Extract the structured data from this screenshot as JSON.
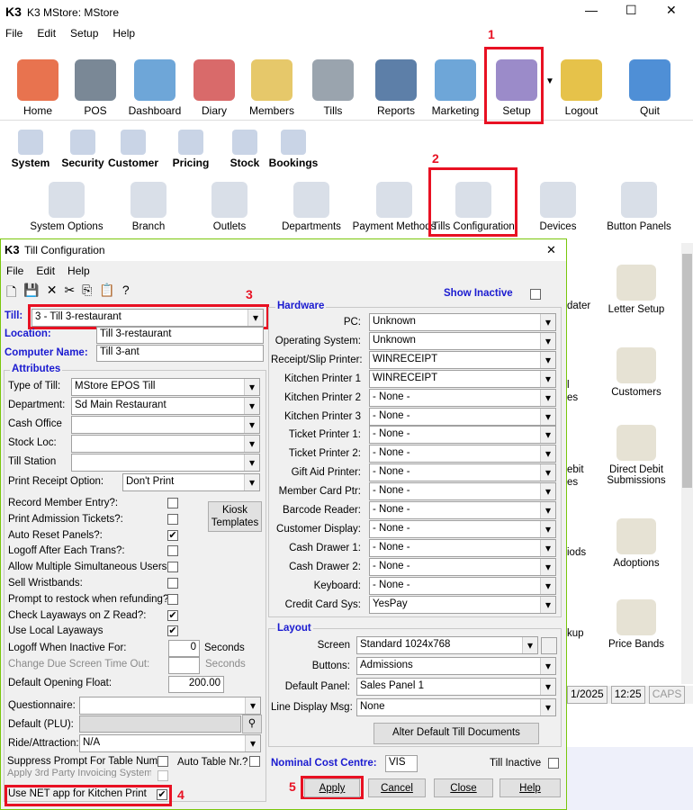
{
  "window": {
    "logo": "K3",
    "title": "K3 MStore: MStore"
  },
  "menu": [
    "File",
    "Edit",
    "Setup",
    "Help"
  ],
  "toolbar": [
    {
      "label": "Home",
      "icon": "house-icon",
      "color": "#e8734f"
    },
    {
      "label": "POS",
      "icon": "pos-terminal-icon",
      "color": "#7a8896"
    },
    {
      "label": "Dashboard",
      "icon": "dashboard-icon",
      "color": "#6ea6d8"
    },
    {
      "label": "Diary",
      "icon": "calendar-icon",
      "color": "#d96a6a"
    },
    {
      "label": "Members",
      "icon": "members-icon",
      "color": "#e6c86a"
    },
    {
      "label": "Tills",
      "icon": "till-icon",
      "color": "#9aa4ae"
    },
    {
      "label": "Reports",
      "icon": "reports-icon",
      "color": "#5d7fa8"
    },
    {
      "label": "Marketing",
      "icon": "network-icon",
      "color": "#6ea6d8"
    },
    {
      "label": "Setup",
      "icon": "gears-icon",
      "color": "#9b8bc9"
    },
    {
      "label": "Logout",
      "icon": "key-icon",
      "color": "#e6c24a"
    },
    {
      "label": "Quit",
      "icon": "arrow-right-icon",
      "color": "#4f8fd6"
    }
  ],
  "subtoolbar": [
    {
      "label": "System",
      "icon": "gears-icon"
    },
    {
      "label": "Security",
      "icon": "shield-icon"
    },
    {
      "label": "Customer",
      "icon": "person-icon"
    },
    {
      "label": "Pricing",
      "icon": "price-tag-icon"
    },
    {
      "label": "Stock",
      "icon": "box-icon"
    },
    {
      "label": "Bookings",
      "icon": "building-icon"
    }
  ],
  "setup_icons": [
    "System Options",
    "Branch",
    "Outlets",
    "Departments",
    "Payment Methods",
    "Tills Configuration",
    "Devices",
    "Button Panels"
  ],
  "right_icons": [
    "Letter Setup",
    "Customers",
    "Direct Debit Submissions",
    "Adoptions",
    "Price Bands"
  ],
  "right_partial": [
    "dater",
    "l",
    "es",
    "ebit",
    "es",
    "iods",
    "kup"
  ],
  "status": {
    "date": "1/2025",
    "time": "12:25",
    "caps": "CAPS"
  },
  "annotations": [
    "1",
    "2",
    "3",
    "4",
    "5"
  ],
  "dialog": {
    "logo": "K3",
    "title": "Till Configuration",
    "close": "✕",
    "menu": [
      "File",
      "Edit",
      "Help"
    ],
    "show_inactive": "Show Inactive",
    "till_label": "Till:",
    "till_value": "3 - Till 3-restaurant",
    "location_label": "Location:",
    "location_value": "Till 3-restaurant",
    "computer_label": "Computer Name:",
    "computer_value": "Till 3-ant",
    "attributes": {
      "title": "Attributes",
      "type_label": "Type of Till:",
      "type_value": "MStore EPOS Till",
      "dept_label": "Department:",
      "dept_value": "Sd Main Restaurant",
      "cash_label": "Cash Office",
      "stock_label": "Stock Loc:",
      "station_label": "Till Station",
      "receipt_label": "Print Receipt Option:",
      "receipt_value": "Don't Print",
      "kiosk": "Kiosk Templates",
      "checks": [
        {
          "label": "Record Member Entry?:",
          "checked": false
        },
        {
          "label": "Print Admission Tickets?:",
          "checked": false
        },
        {
          "label": "Auto Reset Panels?:",
          "checked": true
        },
        {
          "label": "Logoff After Each Trans?:",
          "checked": false
        },
        {
          "label": "Allow Multiple Simultaneous Users?:",
          "checked": false
        },
        {
          "label": "Sell Wristbands:",
          "checked": false
        },
        {
          "label": "Prompt to restock when refunding?:",
          "checked": false
        },
        {
          "label": "Check Layaways on Z Read?:",
          "checked": true
        },
        {
          "label": "Use Local Layaways",
          "checked": true
        }
      ],
      "logoff_label": "Logoff When Inactive For:",
      "logoff_value": "0",
      "seconds": "Seconds",
      "change_label": "Change Due Screen Time Out:",
      "float_label": "Default Opening Float:",
      "float_value": "200.00",
      "quest_label": "Questionnaire:",
      "plu_label": "Default (PLU):",
      "ride_label": "Ride/Attraction:",
      "ride_value": "N/A",
      "suppress_label": "Suppress Prompt For Table Num?",
      "auto_table_label": "Auto Table Nr.?",
      "third_party_label": "Apply 3rd Party Invoicing System?",
      "net_label": "Use NET app for Kitchen Print",
      "net_checked": true
    },
    "hardware": {
      "title": "Hardware",
      "rows": [
        [
          "PC:",
          "Unknown"
        ],
        [
          "Operating System:",
          "Unknown"
        ],
        [
          "Receipt/Slip Printer:",
          "WINRECEIPT"
        ],
        [
          "Kitchen Printer 1",
          "WINRECEIPT"
        ],
        [
          "Kitchen Printer 2",
          "- None -"
        ],
        [
          "Kitchen Printer 3",
          "- None -"
        ],
        [
          "Ticket Printer 1:",
          "- None -"
        ],
        [
          "Ticket Printer 2:",
          "- None -"
        ],
        [
          "Gift Aid Printer:",
          "- None -"
        ],
        [
          "Member Card Ptr:",
          "- None -"
        ],
        [
          "Barcode Reader:",
          "- None -"
        ],
        [
          "Customer Display:",
          "- None -"
        ],
        [
          "Cash Drawer 1:",
          "- None -"
        ],
        [
          "Cash Drawer 2:",
          "- None -"
        ],
        [
          "Keyboard:",
          "- None -"
        ],
        [
          "Credit Card Sys:",
          "YesPay"
        ]
      ]
    },
    "layout": {
      "title": "Layout",
      "rows": [
        [
          "Screen",
          "Standard 1024x768"
        ],
        [
          "Buttons:",
          "Admissions"
        ],
        [
          "Default Panel:",
          "Sales Panel 1"
        ],
        [
          "Line Display Msg:",
          "None"
        ]
      ],
      "alter": "Alter Default Till Documents"
    },
    "nominal_label": "Nominal Cost Centre:",
    "nominal_value": "VIS",
    "till_inactive": "Till Inactive",
    "buttons": {
      "apply": "Apply",
      "cancel": "Cancel",
      "close": "Close",
      "help": "Help"
    }
  }
}
